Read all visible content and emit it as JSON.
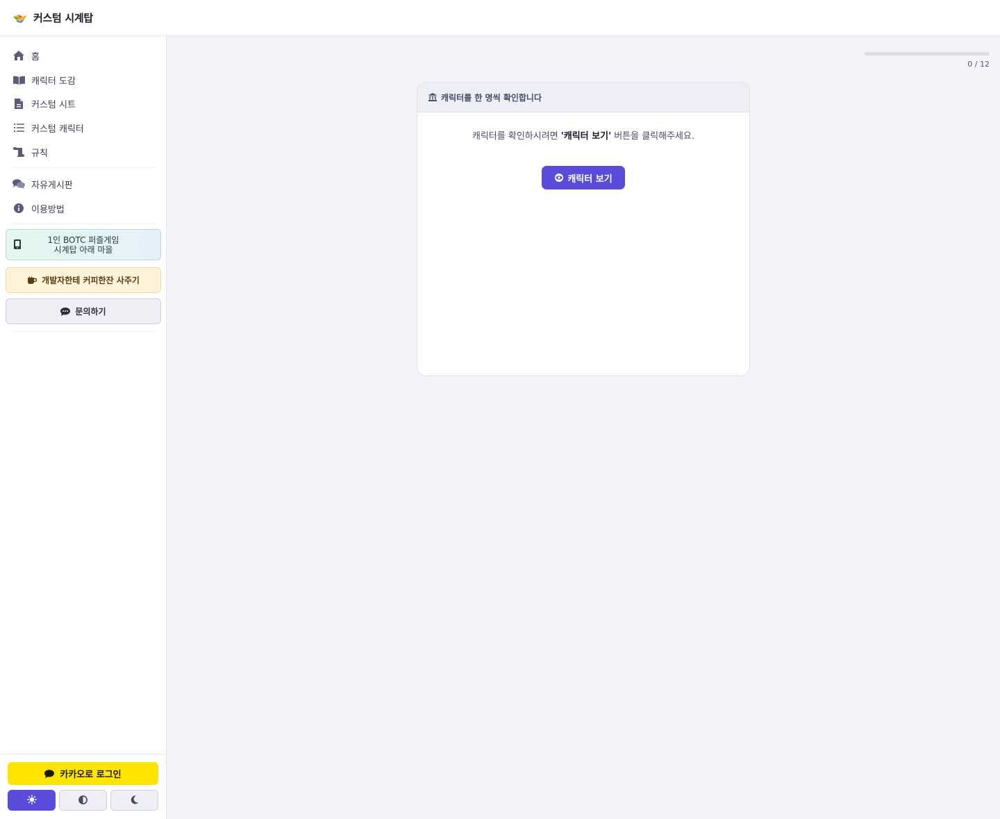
{
  "app": {
    "title": "커스텀 시계탑"
  },
  "sidebar": {
    "items": [
      {
        "label": "홈",
        "icon": "home-icon"
      },
      {
        "label": "캐릭터 도감",
        "icon": "book-icon"
      },
      {
        "label": "커스텀 시트",
        "icon": "document-icon"
      },
      {
        "label": "커스텀 캐릭터",
        "icon": "list-icon"
      },
      {
        "label": "규칙",
        "icon": "scroll-icon"
      },
      {
        "label": "자유게시판",
        "icon": "comments-icon"
      },
      {
        "label": "이용방법",
        "icon": "info-icon"
      }
    ],
    "promo_puzzle_line1": "1인 BOTC 퍼즐게임",
    "promo_puzzle_line2": "시계탑 아래 마을",
    "promo_coffee": "개발자한테 커피한잔 사주기",
    "contact": "문의하기",
    "kakao_login": "카카오로 로그인"
  },
  "progress": {
    "current": 0,
    "total": 12,
    "label": "0 / 12"
  },
  "card": {
    "header": "캐릭터를 한 명씩 확인합니다",
    "message_prefix": "캐릭터를 확인하시려면 ",
    "message_bold": "'캐릭터 보기'",
    "message_suffix": " 버튼을 클릭해주세요.",
    "button": "캐릭터 보기"
  },
  "colors": {
    "accent": "#5b4bdb",
    "kakao": "#fee500"
  }
}
